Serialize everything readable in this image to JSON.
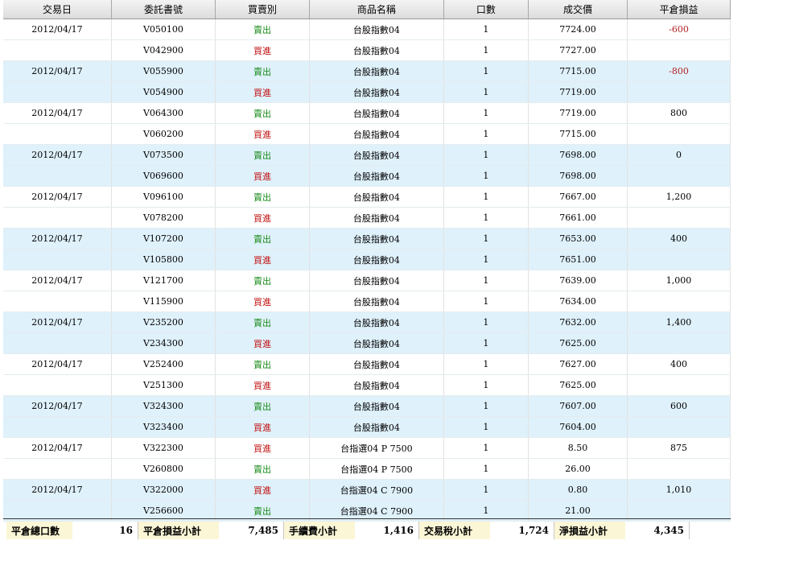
{
  "columns": [
    "交易日",
    "委託書號",
    "買賣別",
    "商品名稱",
    "口數",
    "成交價",
    "平倉損益"
  ],
  "rows": [
    {
      "date": "2012/04/17",
      "order": "V050100",
      "side": "賣出",
      "side_type": "sell",
      "product": "台股指數04",
      "qty": "1",
      "price": "7724.00",
      "pnl": "-600",
      "pnl_negative": true
    },
    {
      "date": "",
      "order": "V042900",
      "side": "買進",
      "side_type": "buy",
      "product": "台股指數04",
      "qty": "1",
      "price": "7727.00",
      "pnl": ""
    },
    {
      "date": "2012/04/17",
      "order": "V055900",
      "side": "賣出",
      "side_type": "sell",
      "product": "台股指數04",
      "qty": "1",
      "price": "7715.00",
      "pnl": "-800",
      "pnl_negative": true
    },
    {
      "date": "",
      "order": "V054900",
      "side": "買進",
      "side_type": "buy",
      "product": "台股指數04",
      "qty": "1",
      "price": "7719.00",
      "pnl": ""
    },
    {
      "date": "2012/04/17",
      "order": "V064300",
      "side": "賣出",
      "side_type": "sell",
      "product": "台股指數04",
      "qty": "1",
      "price": "7719.00",
      "pnl": "800"
    },
    {
      "date": "",
      "order": "V060200",
      "side": "買進",
      "side_type": "buy",
      "product": "台股指數04",
      "qty": "1",
      "price": "7715.00",
      "pnl": ""
    },
    {
      "date": "2012/04/17",
      "order": "V073500",
      "side": "賣出",
      "side_type": "sell",
      "product": "台股指數04",
      "qty": "1",
      "price": "7698.00",
      "pnl": "0"
    },
    {
      "date": "",
      "order": "V069600",
      "side": "買進",
      "side_type": "buy",
      "product": "台股指數04",
      "qty": "1",
      "price": "7698.00",
      "pnl": ""
    },
    {
      "date": "2012/04/17",
      "order": "V096100",
      "side": "賣出",
      "side_type": "sell",
      "product": "台股指數04",
      "qty": "1",
      "price": "7667.00",
      "pnl": "1,200"
    },
    {
      "date": "",
      "order": "V078200",
      "side": "買進",
      "side_type": "buy",
      "product": "台股指數04",
      "qty": "1",
      "price": "7661.00",
      "pnl": ""
    },
    {
      "date": "2012/04/17",
      "order": "V107200",
      "side": "賣出",
      "side_type": "sell",
      "product": "台股指數04",
      "qty": "1",
      "price": "7653.00",
      "pnl": "400"
    },
    {
      "date": "",
      "order": "V105800",
      "side": "買進",
      "side_type": "buy",
      "product": "台股指數04",
      "qty": "1",
      "price": "7651.00",
      "pnl": ""
    },
    {
      "date": "2012/04/17",
      "order": "V121700",
      "side": "賣出",
      "side_type": "sell",
      "product": "台股指數04",
      "qty": "1",
      "price": "7639.00",
      "pnl": "1,000"
    },
    {
      "date": "",
      "order": "V115900",
      "side": "買進",
      "side_type": "buy",
      "product": "台股指數04",
      "qty": "1",
      "price": "7634.00",
      "pnl": ""
    },
    {
      "date": "2012/04/17",
      "order": "V235200",
      "side": "賣出",
      "side_type": "sell",
      "product": "台股指數04",
      "qty": "1",
      "price": "7632.00",
      "pnl": "1,400"
    },
    {
      "date": "",
      "order": "V234300",
      "side": "買進",
      "side_type": "buy",
      "product": "台股指數04",
      "qty": "1",
      "price": "7625.00",
      "pnl": ""
    },
    {
      "date": "2012/04/17",
      "order": "V252400",
      "side": "賣出",
      "side_type": "sell",
      "product": "台股指數04",
      "qty": "1",
      "price": "7627.00",
      "pnl": "400"
    },
    {
      "date": "",
      "order": "V251300",
      "side": "買進",
      "side_type": "buy",
      "product": "台股指數04",
      "qty": "1",
      "price": "7625.00",
      "pnl": ""
    },
    {
      "date": "2012/04/17",
      "order": "V324300",
      "side": "賣出",
      "side_type": "sell",
      "product": "台股指數04",
      "qty": "1",
      "price": "7607.00",
      "pnl": "600"
    },
    {
      "date": "",
      "order": "V323400",
      "side": "買進",
      "side_type": "buy",
      "product": "台股指數04",
      "qty": "1",
      "price": "7604.00",
      "pnl": ""
    },
    {
      "date": "2012/04/17",
      "order": "V322300",
      "side": "買進",
      "side_type": "buy",
      "product": "台指選04 P 7500",
      "qty": "1",
      "price": "8.50",
      "pnl": "875"
    },
    {
      "date": "",
      "order": "V260800",
      "side": "賣出",
      "side_type": "sell",
      "product": "台指選04 P 7500",
      "qty": "1",
      "price": "26.00",
      "pnl": ""
    },
    {
      "date": "2012/04/17",
      "order": "V322000",
      "side": "買進",
      "side_type": "buy",
      "product": "台指選04 C 7900",
      "qty": "1",
      "price": "0.80",
      "pnl": "1,010"
    },
    {
      "date": "",
      "order": "V256600",
      "side": "賣出",
      "side_type": "sell",
      "product": "台指選04 C 7900",
      "qty": "1",
      "price": "21.00",
      "pnl": ""
    }
  ],
  "footer": [
    {
      "label": "平倉總口數",
      "value": "16"
    },
    {
      "label": "平倉損益小計",
      "value": "7,485"
    },
    {
      "label": "手續費小計",
      "value": "1,416"
    },
    {
      "label": "交易稅小計",
      "value": "1,724"
    },
    {
      "label": "淨損益小計",
      "value": "4,345"
    }
  ],
  "colors": {
    "sell": "#1a8c1a",
    "buy": "#c01010",
    "negative": "#b22222",
    "alt_row": "#dff1fb"
  }
}
